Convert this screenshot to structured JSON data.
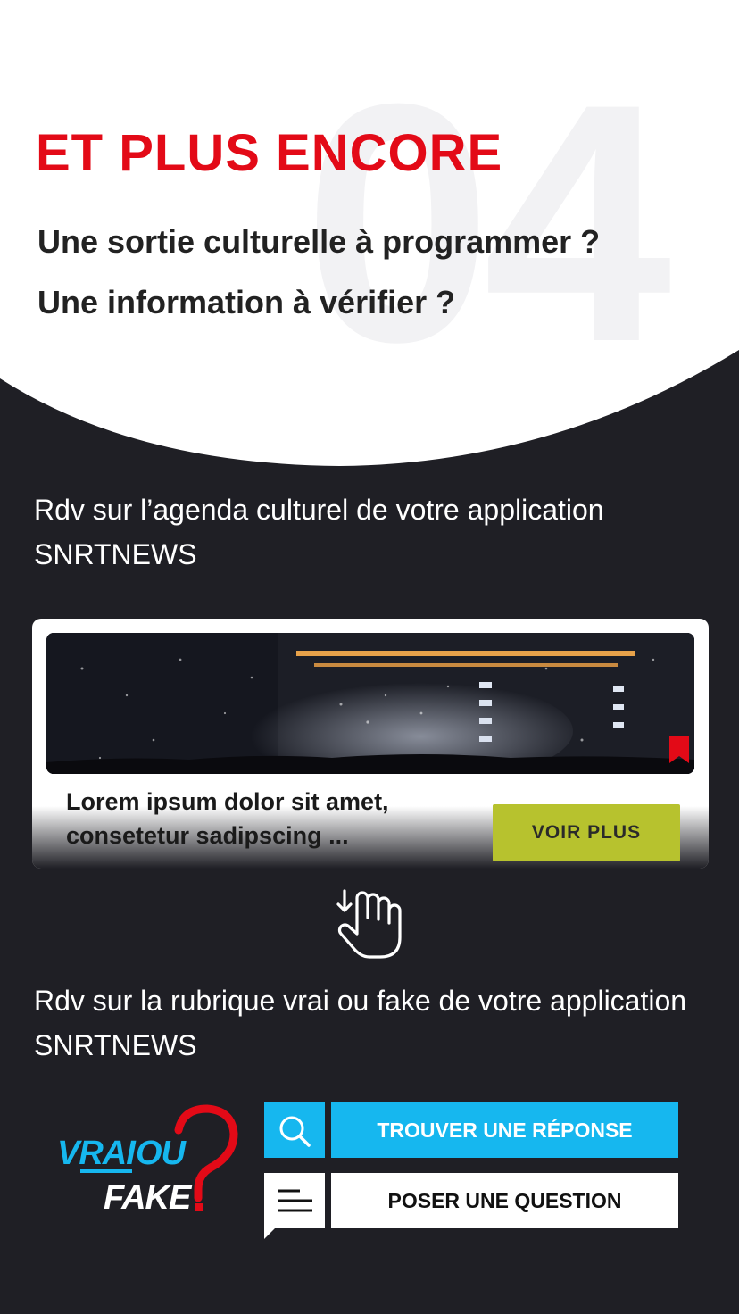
{
  "header": {
    "section_number": "04",
    "title": "ET PLUS ENCORE",
    "question_1": "Une sortie culturelle à programmer ?",
    "question_2": "Une information à vérifier ?"
  },
  "agenda": {
    "intro": "Rdv sur l’agenda culturel de votre application SNRTNEWS",
    "card": {
      "title": "Lorem ipsum dolor sit amet, consetetur sadipscing ...",
      "button_label": "VOIR PLUS"
    }
  },
  "vrai_ou_fake": {
    "intro": "Rdv sur la rubrique vrai ou fake de votre application SNRTNEWS",
    "logo_text": "VRAI OU FAKE",
    "find_answer_label": "TROUVER UNE RÉPONSE",
    "ask_question_label": "POSER UNE QUESTION"
  },
  "colors": {
    "accent_red": "#e30a17",
    "dark_bg": "#1f1f25",
    "find_blue": "#16b7ef",
    "voir_plus_green": "#b7c22e"
  },
  "icons": [
    "bookmark-icon",
    "tap-hand-icon",
    "search-icon",
    "menu-icon"
  ]
}
